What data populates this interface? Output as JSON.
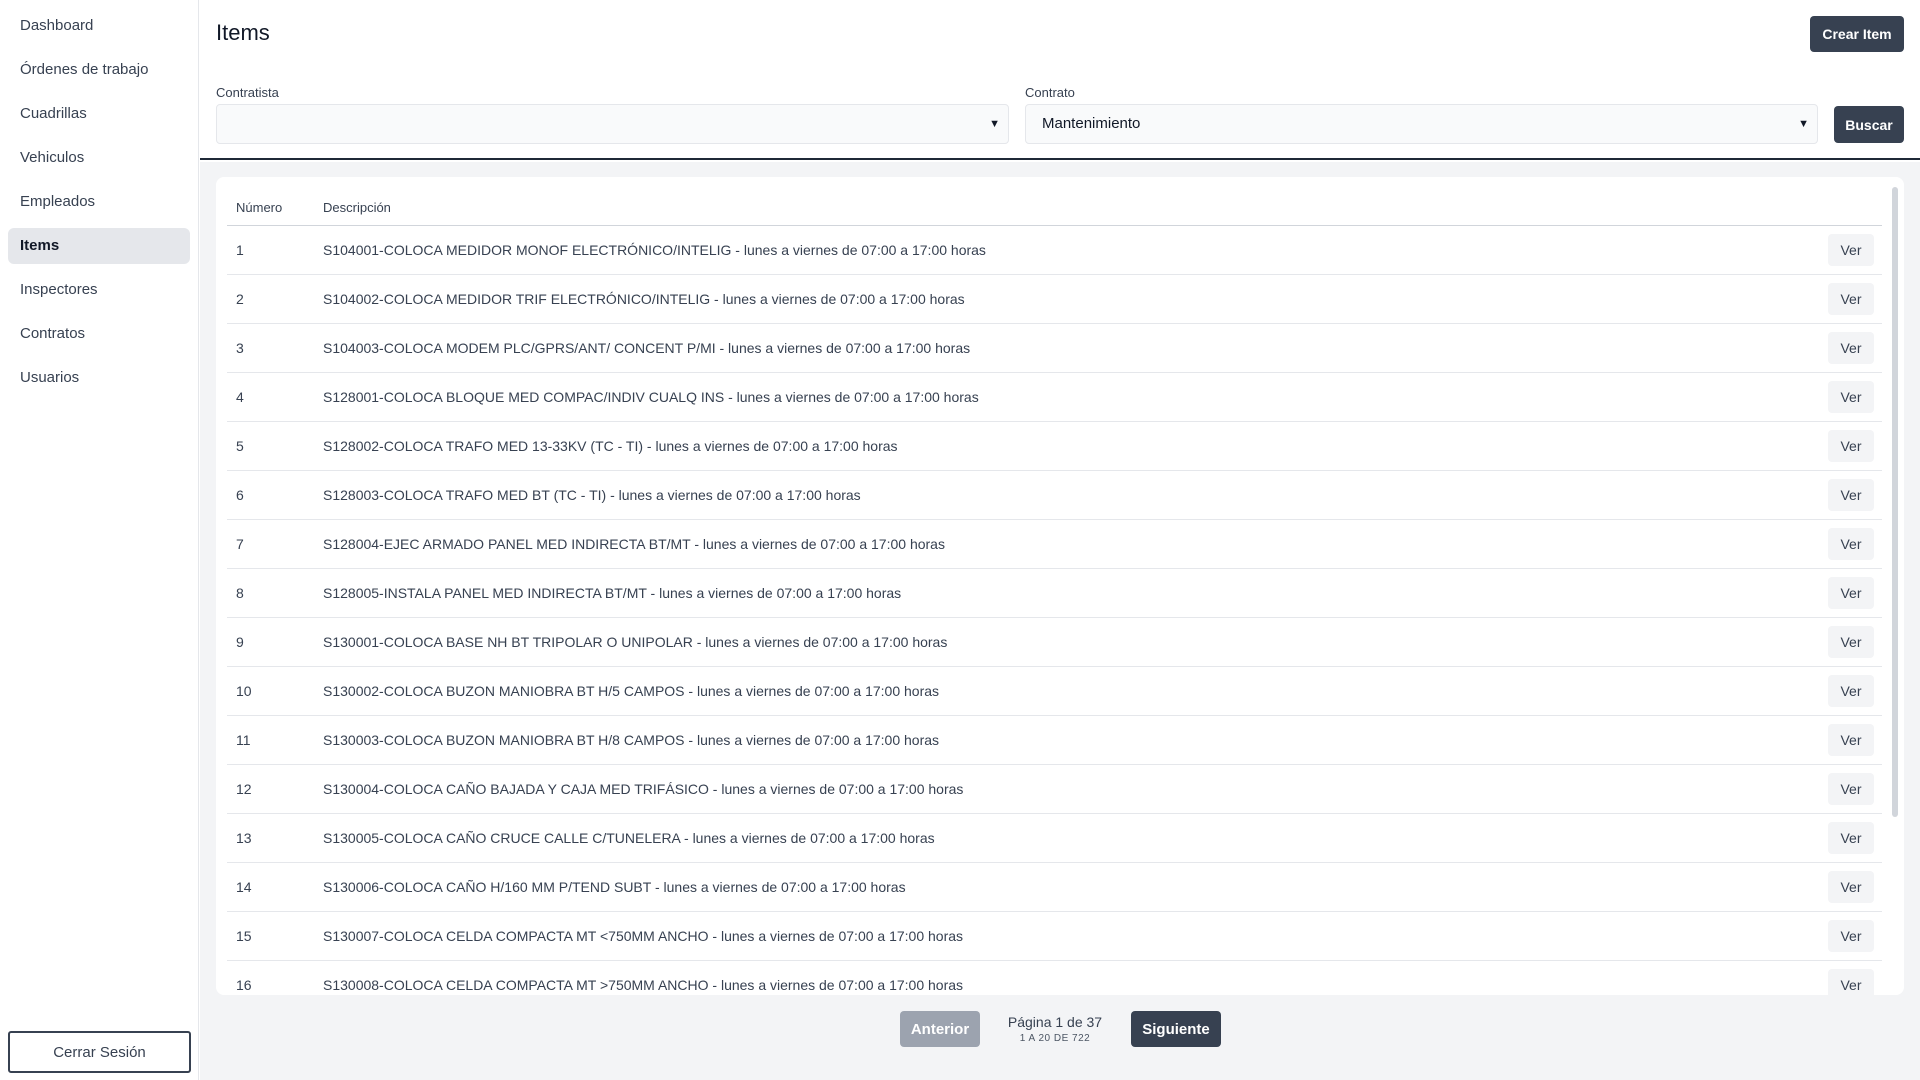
{
  "sidebar": {
    "items": [
      {
        "label": "Dashboard"
      },
      {
        "label": "Órdenes de trabajo"
      },
      {
        "label": "Cuadrillas"
      },
      {
        "label": "Vehiculos"
      },
      {
        "label": "Empleados"
      },
      {
        "label": "Items",
        "active": true
      },
      {
        "label": "Inspectores"
      },
      {
        "label": "Contratos"
      },
      {
        "label": "Usuarios"
      }
    ],
    "logout_label": "Cerrar Sesión"
  },
  "header": {
    "title": "Items",
    "create_label": "Crear Item"
  },
  "filters": {
    "contratista_label": "Contratista",
    "contratista_value": "",
    "contrato_label": "Contrato",
    "contrato_value": "Mantenimiento",
    "search_label": "Buscar"
  },
  "table": {
    "columns": [
      "Número",
      "Descripción"
    ],
    "action_label": "Ver",
    "rows": [
      {
        "num": "1",
        "desc": "S104001-COLOCA MEDIDOR MONOF ELECTRÓNICO/INTELIG - lunes a viernes de 07:00 a 17:00 horas"
      },
      {
        "num": "2",
        "desc": "S104002-COLOCA MEDIDOR TRIF ELECTRÓNICO/INTELIG - lunes a viernes de 07:00 a 17:00 horas"
      },
      {
        "num": "3",
        "desc": "S104003-COLOCA MODEM PLC/GPRS/ANT/ CONCENT P/MI - lunes a viernes de 07:00 a 17:00 horas"
      },
      {
        "num": "4",
        "desc": "S128001-COLOCA BLOQUE MED COMPAC/INDIV CUALQ INS - lunes a viernes de 07:00 a 17:00 horas"
      },
      {
        "num": "5",
        "desc": "S128002-COLOCA TRAFO MED 13-33KV (TC - TI) - lunes a viernes de 07:00 a 17:00 horas"
      },
      {
        "num": "6",
        "desc": "S128003-COLOCA TRAFO MED BT (TC - TI) - lunes a viernes de 07:00 a 17:00 horas"
      },
      {
        "num": "7",
        "desc": "S128004-EJEC ARMADO PANEL MED INDIRECTA BT/MT - lunes a viernes de 07:00 a 17:00 horas"
      },
      {
        "num": "8",
        "desc": "S128005-INSTALA PANEL MED INDIRECTA BT/MT - lunes a viernes de 07:00 a 17:00 horas"
      },
      {
        "num": "9",
        "desc": "S130001-COLOCA BASE NH BT TRIPOLAR O UNIPOLAR - lunes a viernes de 07:00 a 17:00 horas"
      },
      {
        "num": "10",
        "desc": "S130002-COLOCA BUZON MANIOBRA BT H/5 CAMPOS - lunes a viernes de 07:00 a 17:00 horas"
      },
      {
        "num": "11",
        "desc": "S130003-COLOCA BUZON MANIOBRA BT H/8 CAMPOS - lunes a viernes de 07:00 a 17:00 horas"
      },
      {
        "num": "12",
        "desc": "S130004-COLOCA CAÑO BAJADA Y CAJA MED TRIFÁSICO - lunes a viernes de 07:00 a 17:00 horas"
      },
      {
        "num": "13",
        "desc": "S130005-COLOCA CAÑO CRUCE CALLE C/TUNELERA - lunes a viernes de 07:00 a 17:00 horas"
      },
      {
        "num": "14",
        "desc": "S130006-COLOCA CAÑO H/160 MM P/TEND SUBT - lunes a viernes de 07:00 a 17:00 horas"
      },
      {
        "num": "15",
        "desc": "S130007-COLOCA CELDA COMPACTA MT <750MM ANCHO - lunes a viernes de 07:00 a 17:00 horas"
      },
      {
        "num": "16",
        "desc": "S130008-COLOCA CELDA COMPACTA MT >750MM ANCHO - lunes a viernes de 07:00 a 17:00 horas"
      }
    ]
  },
  "pagination": {
    "prev_label": "Anterior",
    "next_label": "Siguiente",
    "page_text": "Página 1 de 37",
    "range_text": "1 A 20 DE 722"
  }
}
